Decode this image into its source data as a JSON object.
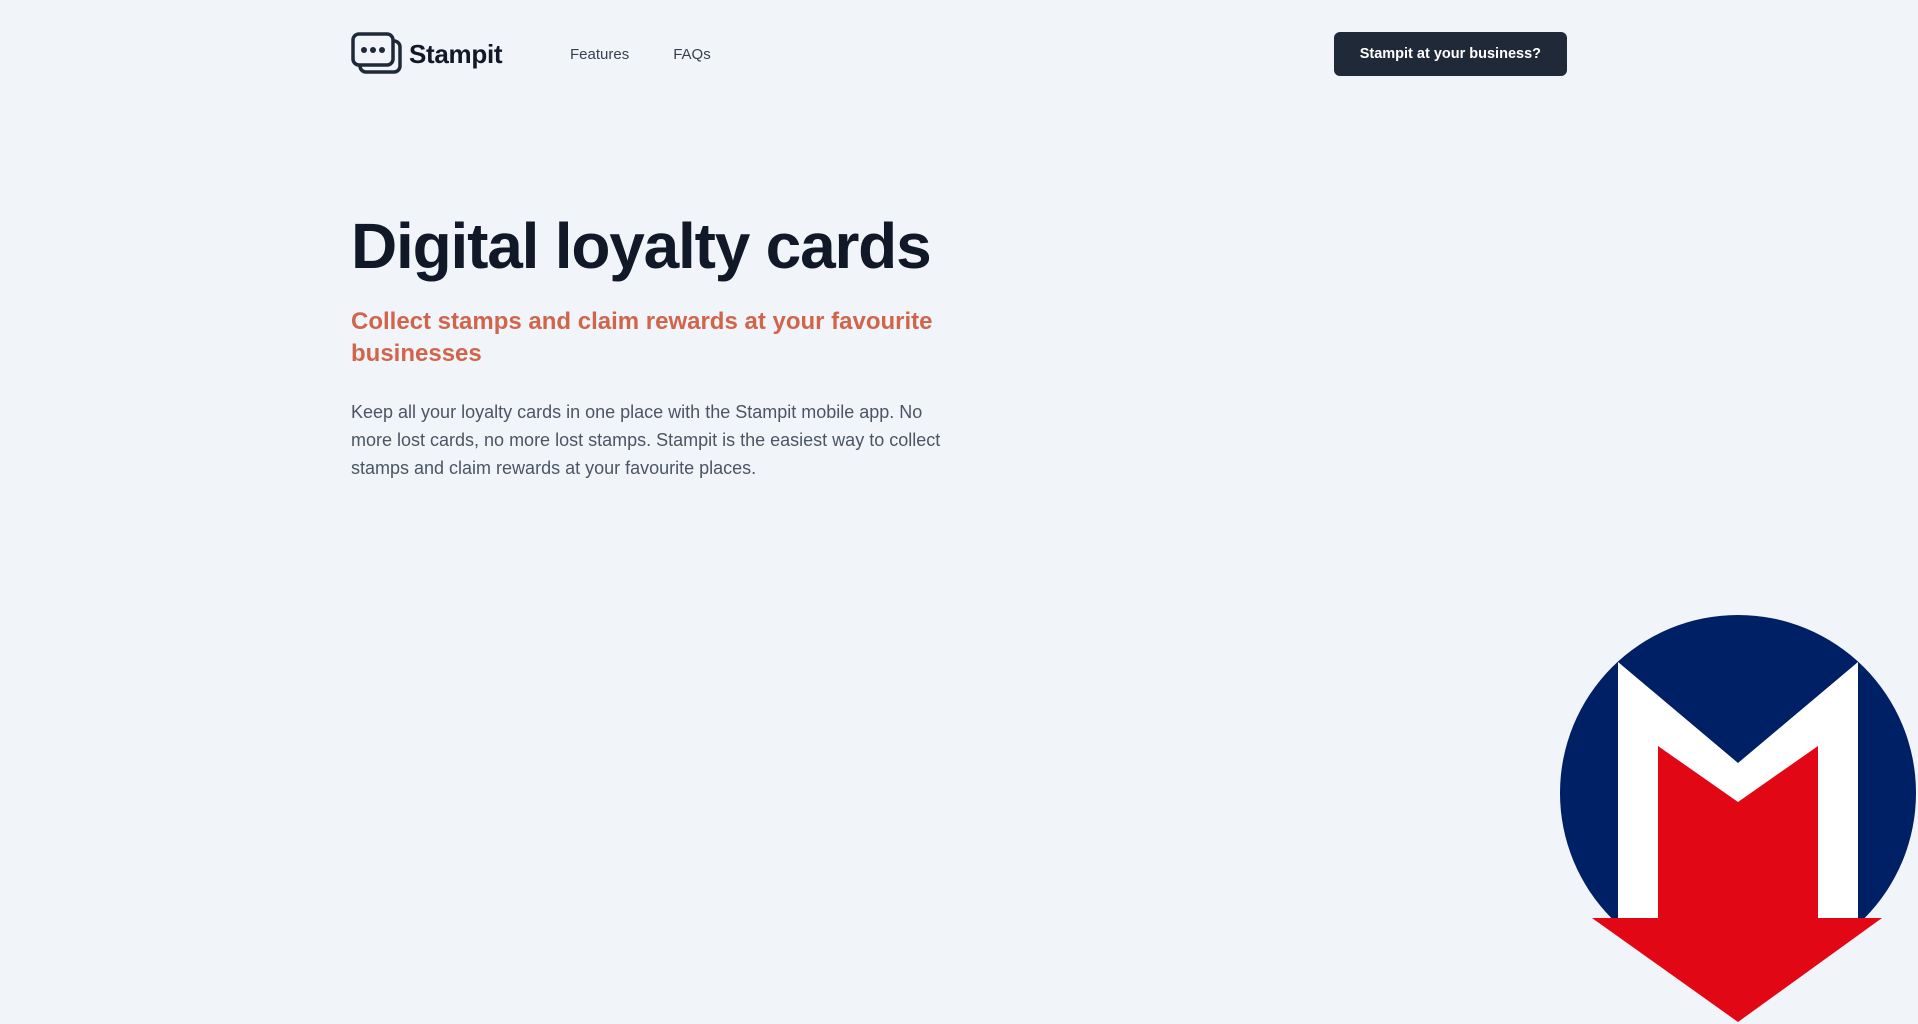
{
  "header": {
    "logo_text": "Stampit",
    "logo_icon": "card-stack-icon",
    "nav": {
      "features_label": "Features",
      "faqs_label": "FAQs"
    },
    "cta_label": "Stampit at your business?"
  },
  "hero": {
    "title": "Digital loyalty cards",
    "subtitle": "Collect stamps and claim rewards at your favourite businesses",
    "description": "Keep all your loyalty cards in one place with the Stampit mobile app. No more lost cards, no more lost stamps. Stampit is the easiest way to collect stamps and claim rewards at your favourite places."
  },
  "overlay": {
    "icon": "metro-m-arrow-logo"
  },
  "colors": {
    "background": "#f1f5f9",
    "text_dark": "#111827",
    "accent": "#d0654b",
    "button_bg": "#1f2937",
    "metro_blue": "#002065",
    "metro_red": "#e20714"
  }
}
